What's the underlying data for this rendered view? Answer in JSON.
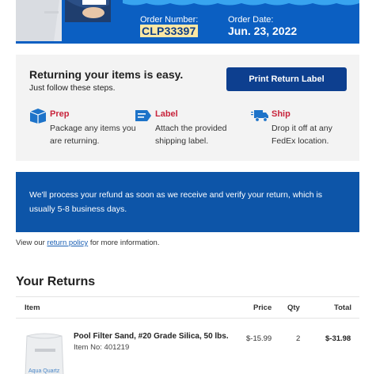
{
  "colors": {
    "hero_blue": "#0b5fc2",
    "nav_blue": "#0d3f8f",
    "refund_blue": "#0d55a8",
    "highlight": "#fbe7a3",
    "step_red": "#c8243c",
    "link_blue": "#1a5fb4"
  },
  "order": {
    "number_label": "Order Number:",
    "number": "CLP33397",
    "date_label": "Order Date:",
    "date": "Jun. 23, 2022"
  },
  "steps_panel": {
    "heading": "Returning your items is easy.",
    "subheading": "Just follow these steps.",
    "print_button": "Print Return Label",
    "steps": [
      {
        "icon": "box-icon",
        "title": "Prep",
        "desc": "Package any items you are returning."
      },
      {
        "icon": "label-icon",
        "title": "Label",
        "desc": "Attach the provided shipping label."
      },
      {
        "icon": "truck-icon",
        "title": "Ship",
        "desc": "Drop it off at any FedEx location."
      }
    ]
  },
  "refund_notice": "We'll process your refund as soon as we receive and verify your return, which is usually 5-8 business days.",
  "policy": {
    "prefix": "View our ",
    "link": "return policy",
    "suffix": " for more information."
  },
  "returns": {
    "title": "Your Returns",
    "columns": {
      "item": "Item",
      "price": "Price",
      "qty": "Qty",
      "total": "Total"
    },
    "items": [
      {
        "name": "Pool Filter Sand, #20 Grade Silica, 50 lbs.",
        "item_no": "Item No: 401219",
        "price": "$-15.99",
        "qty": "2",
        "total": "$-31.98",
        "image_text": "Aqua Quartz"
      }
    ]
  }
}
